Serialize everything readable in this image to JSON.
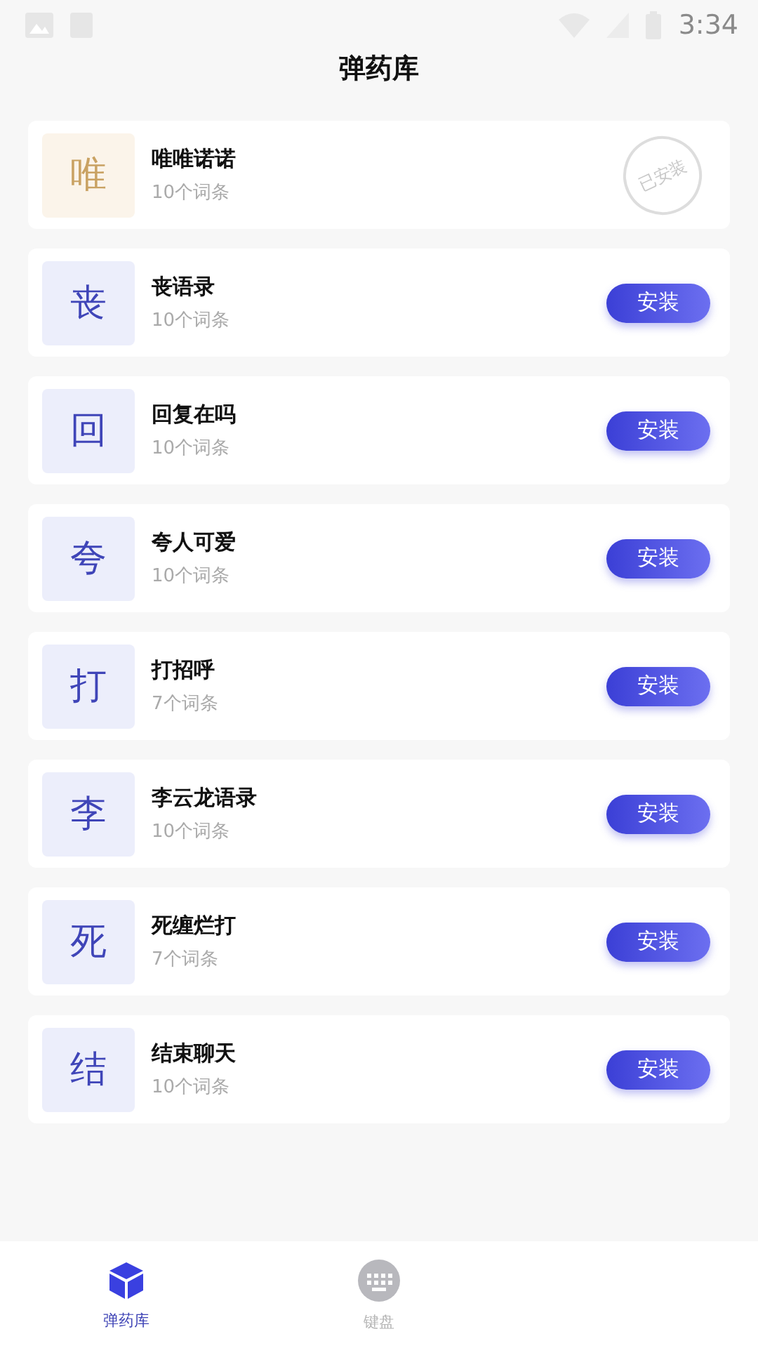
{
  "status_bar": {
    "time": "3:34"
  },
  "title": "弹药库",
  "packs": [
    {
      "initial": "唯",
      "name": "唯唯诺诺",
      "count": "10个词条",
      "installed": true,
      "action": "已安装"
    },
    {
      "initial": "丧",
      "name": "丧语录",
      "count": "10个词条",
      "installed": false,
      "action": "安装"
    },
    {
      "initial": "回",
      "name": "回复在吗",
      "count": "10个词条",
      "installed": false,
      "action": "安装"
    },
    {
      "initial": "夸",
      "name": "夸人可爱",
      "count": "10个词条",
      "installed": false,
      "action": "安装"
    },
    {
      "initial": "打",
      "name": "打招呼",
      "count": "7个词条",
      "installed": false,
      "action": "安装"
    },
    {
      "initial": "李",
      "name": "李云龙语录",
      "count": "10个词条",
      "installed": false,
      "action": "安装"
    },
    {
      "initial": "死",
      "name": "死缠烂打",
      "count": "7个词条",
      "installed": false,
      "action": "安装"
    },
    {
      "initial": "结",
      "name": "结束聊天",
      "count": "10个词条",
      "installed": false,
      "action": "安装"
    }
  ],
  "tabs": [
    {
      "label": "弹药库",
      "kind": "cube",
      "selected": true
    },
    {
      "label": "键盘",
      "kind": "keyboard",
      "selected": false
    }
  ]
}
